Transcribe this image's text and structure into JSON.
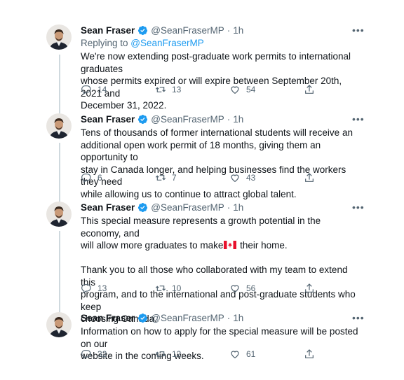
{
  "tweets": [
    {
      "name": "Sean Fraser",
      "handle": "@SeanFraserMP",
      "time": "1h",
      "replying_prefix": "Replying to ",
      "replying_handle": "@SeanFraserMP",
      "text": "We're now extending post-graduate work permits to international graduates\nwhose permits expired or will expire between September 20th, 2021 and\nDecember 31, 2022.",
      "replies": "14",
      "retweets": "13",
      "likes": "54"
    },
    {
      "name": "Sean Fraser",
      "handle": "@SeanFraserMP",
      "time": "1h",
      "text": "Tens of thousands of former international students will receive an\nadditional open work permit of 18 months, giving them an opportunity to\nstay in Canada longer, and helping businesses find the workers they need\nwhile allowing us to continue to attract global talent.",
      "replies": "6",
      "retweets": "7",
      "likes": "43"
    },
    {
      "name": "Sean Fraser",
      "handle": "@SeanFraserMP",
      "time": "1h",
      "text_line1": "This special measure represents a growth potential in the   economy, and",
      "text_line2a": "will allow more graduates to make",
      "text_line2b": " their home.",
      "text_rest": "Thank you to all those who collaborated with my team to extend this\nprogram, and to the international and post-graduate students who keep\nchoosing Canada.",
      "replies": "13",
      "retweets": "10",
      "likes": "56"
    },
    {
      "name": "Sean Fraser",
      "handle": "@SeanFraserMP",
      "time": "1h",
      "text": "Information on how to apply for the special measure will be posted on our\nwebsite in the coming weeks.",
      "replies": "32",
      "retweets": "12",
      "likes": "61"
    }
  ],
  "more_label": "•••",
  "separator": "·"
}
